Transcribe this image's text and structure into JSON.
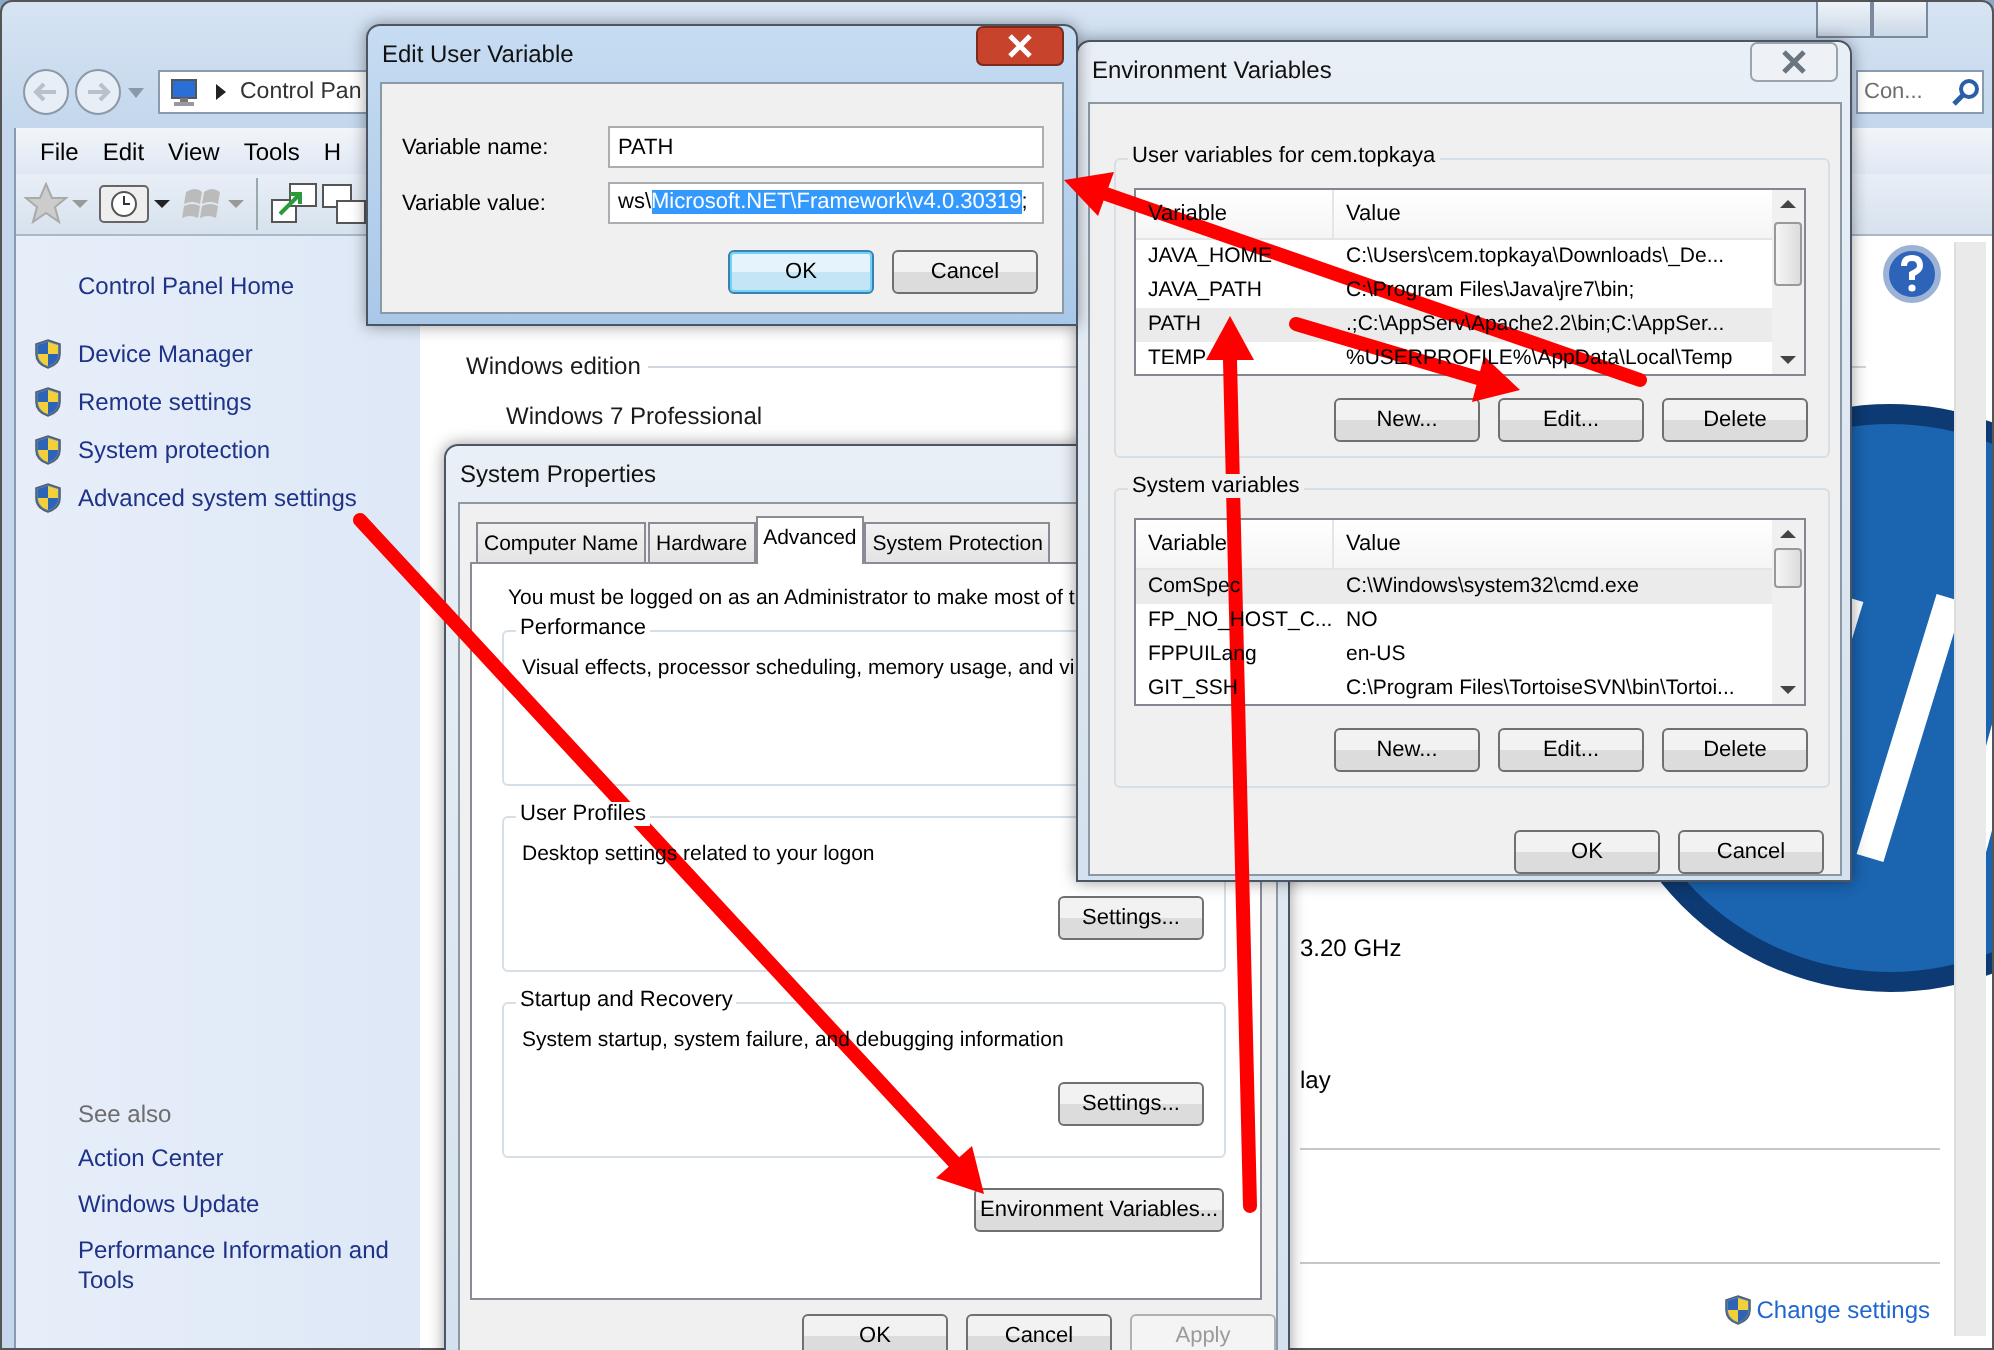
{
  "control_panel": {
    "address": "Control Pan",
    "search_placeholder": "Con...",
    "menu": [
      "File",
      "Edit",
      "View",
      "Tools",
      "H"
    ],
    "sidebar": {
      "home": "Control Panel Home",
      "links": [
        "Device Manager",
        "Remote settings",
        "System protection",
        "Advanced system settings"
      ],
      "see_also_title": "See also",
      "see_also": [
        "Action Center",
        "Windows Update",
        "Performance Information and Tools"
      ]
    },
    "content": {
      "section": "Windows edition",
      "edition": "Windows 7 Professional",
      "processor": "3.20 GHz",
      "display": "lay",
      "change_settings": "Change settings"
    }
  },
  "system_properties": {
    "title": "System Properties",
    "tabs": [
      {
        "label": "Computer Name",
        "selected": false
      },
      {
        "label": "Hardware",
        "selected": false
      },
      {
        "label": "Advanced",
        "selected": true
      },
      {
        "label": "System Protection",
        "selected": false
      }
    ],
    "notice": "You must be logged on as an Administrator to make most of t",
    "groups": [
      {
        "title": "Performance",
        "text": "Visual effects, processor scheduling, memory usage, and vi"
      },
      {
        "title": "User Profiles",
        "text": "Desktop settings related to your logon",
        "button": "Settings..."
      },
      {
        "title": "Startup and Recovery",
        "text": "System startup, system failure, and debugging information",
        "button": "Settings..."
      }
    ],
    "env_button": "Environment Variables...",
    "buttons": [
      {
        "label": "OK",
        "disabled": false
      },
      {
        "label": "Cancel",
        "disabled": false
      },
      {
        "label": "Apply",
        "disabled": true
      }
    ]
  },
  "environment_variables": {
    "title": "Environment Variables",
    "lists": [
      {
        "title": "User variables for cem.topkaya",
        "columns": [
          "Variable",
          "Value"
        ],
        "rows": [
          {
            "variable": "JAVA_HOME",
            "value": "C:\\Users\\cem.topkaya\\Downloads\\_De...",
            "selected": false
          },
          {
            "variable": "JAVA_PATH",
            "value": "C:\\Program Files\\Java\\jre7\\bin;",
            "selected": false
          },
          {
            "variable": "PATH",
            "value": ".;C:\\AppServ\\Apache2.2\\bin;C:\\AppSer...",
            "selected": true
          },
          {
            "variable": "TEMP",
            "value": "%USERPROFILE%\\AppData\\Local\\Temp",
            "selected": false
          }
        ],
        "buttons": [
          "New...",
          "Edit...",
          "Delete"
        ]
      },
      {
        "title": "System variables",
        "columns": [
          "Variable",
          "Value"
        ],
        "rows": [
          {
            "variable": "ComSpec",
            "value": "C:\\Windows\\system32\\cmd.exe",
            "selected": true
          },
          {
            "variable": "FP_NO_HOST_C...",
            "value": "NO",
            "selected": false
          },
          {
            "variable": "FPPUILang",
            "value": "en-US",
            "selected": false
          },
          {
            "variable": "GIT_SSH",
            "value": "C:\\Program Files\\TortoiseSVN\\bin\\Tortoi...",
            "selected": false
          }
        ],
        "buttons": [
          "New...",
          "Edit...",
          "Delete"
        ]
      }
    ],
    "buttons": [
      "OK",
      "Cancel"
    ]
  },
  "edit_variable": {
    "title": "Edit User Variable",
    "name_label": "Variable name:",
    "name_value": "PATH",
    "value_label": "Variable value:",
    "value_before": "ws\\",
    "value_selected": "Microsoft.NET\\Framework\\v4.0.30319",
    "value_after": ";",
    "buttons": [
      {
        "label": "OK",
        "default": true
      },
      {
        "label": "Cancel",
        "default": false
      }
    ]
  }
}
